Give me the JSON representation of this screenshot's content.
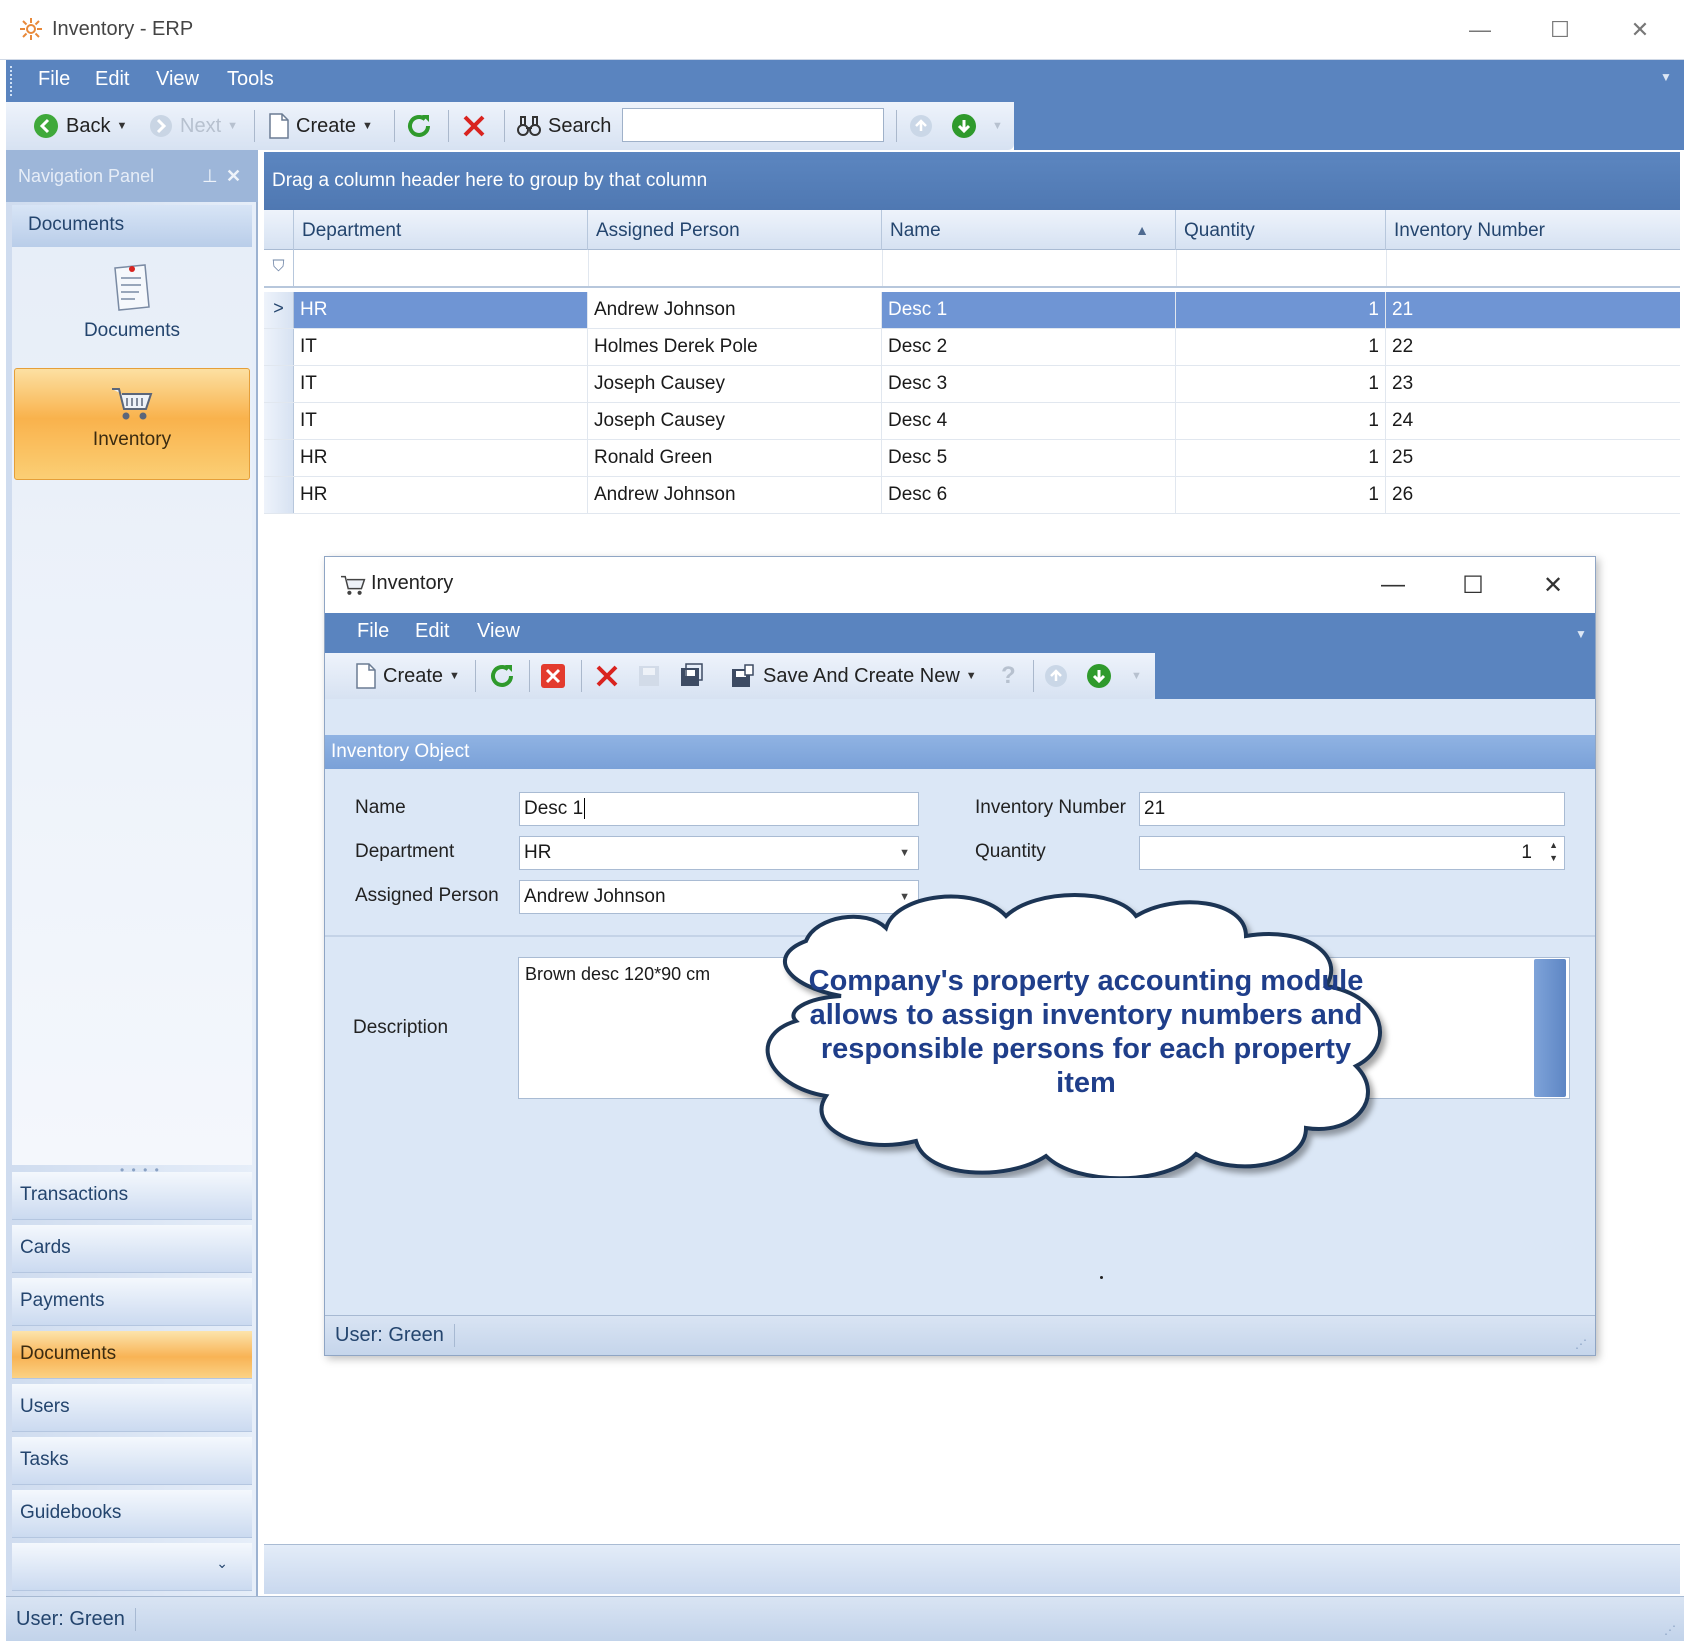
{
  "window": {
    "title": "Inventory - ERP"
  },
  "menu": [
    "File",
    "Edit",
    "View",
    "Tools"
  ],
  "toolbar": {
    "back_label": "Back",
    "next_label": "Next",
    "create_label": "Create",
    "search_label": "Search",
    "search_value": ""
  },
  "nav": {
    "header": "Navigation Panel",
    "group_title": "Documents",
    "tiles": [
      {
        "label": "Documents",
        "icon": "documents-icon"
      },
      {
        "label": "Inventory",
        "icon": "shopping-cart-icon",
        "active": true
      }
    ],
    "buttons": [
      "Transactions",
      "Cards",
      "Payments",
      "Documents",
      "Users",
      "Tasks",
      "Guidebooks"
    ],
    "active_button": "Documents"
  },
  "grid": {
    "group_hint": "Drag a column header here to group by that column",
    "columns": [
      "Department",
      "Assigned Person",
      "Name",
      "Quantity",
      "Inventory Number"
    ],
    "sorted_column": "Name",
    "sort_direction": "ascending",
    "rows": [
      {
        "department": "HR",
        "person": "Andrew Johnson",
        "name": "Desc 1",
        "quantity": "1",
        "number": "21"
      },
      {
        "department": "IT",
        "person": "Holmes Derek Pole",
        "name": "Desc 2",
        "quantity": "1",
        "number": "22"
      },
      {
        "department": "IT",
        "person": "Joseph Causey",
        "name": "Desc 3",
        "quantity": "1",
        "number": "23"
      },
      {
        "department": "IT",
        "person": "Joseph Causey",
        "name": "Desc 4",
        "quantity": "1",
        "number": "24"
      },
      {
        "department": "HR",
        "person": "Ronald Green",
        "name": "Desc 5",
        "quantity": "1",
        "number": "25"
      },
      {
        "department": "HR",
        "person": "Andrew Johnson",
        "name": "Desc 6",
        "quantity": "1",
        "number": "26"
      }
    ],
    "selected_row": 0
  },
  "status": {
    "user": "User: Green"
  },
  "dialog": {
    "title": "Inventory",
    "menu": [
      "File",
      "Edit",
      "View"
    ],
    "toolbar": {
      "create_label": "Create",
      "save_new_label": "Save And Create New"
    },
    "section_title": "Inventory Object",
    "fields": {
      "name_label": "Name",
      "name_value": "Desc 1",
      "inv_number_label": "Inventory Number",
      "inv_number_value": "21",
      "department_label": "Department",
      "department_value": "HR",
      "quantity_label": "Quantity",
      "quantity_value": "1",
      "person_label": "Assigned Person",
      "person_value": "Andrew Johnson",
      "description_label": "Description",
      "description_value": "Brown desc 120*90 cm"
    },
    "status_user": "User: Green"
  },
  "callout": {
    "text": "Company's property accounting module allows to assign inventory numbers and responsible persons for each property item"
  },
  "colors": {
    "accent_blue": "#5a84bf",
    "selection": "#6f95d4",
    "active_orange": "#f9b24c",
    "callout_text": "#1f3e8a"
  }
}
